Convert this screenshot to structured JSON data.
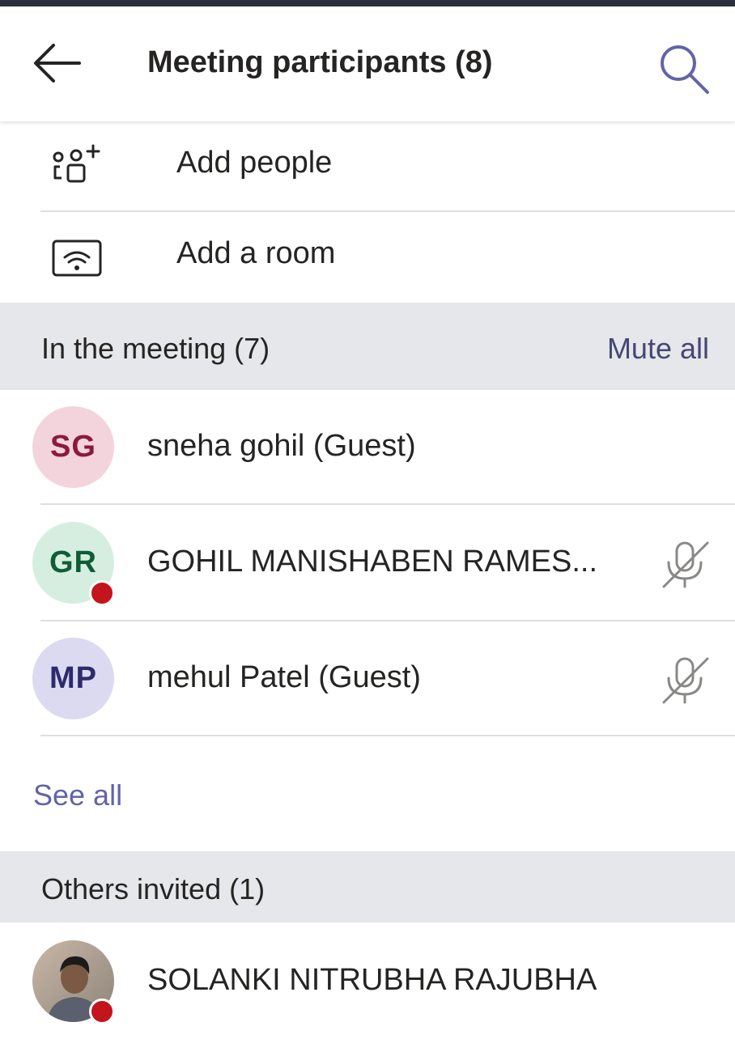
{
  "header": {
    "title": "Meeting participants (8)",
    "back_icon": "arrow-left-icon",
    "search_icon": "search-icon"
  },
  "actions": [
    {
      "label": "Add people",
      "icon": "add-people-icon"
    },
    {
      "label": "Add a room",
      "icon": "room-wifi-icon"
    }
  ],
  "in_meeting": {
    "title": "In the meeting (7)",
    "mute_all": "Mute all",
    "participants": [
      {
        "initials": "SG",
        "name": "sneha gohil (Guest)",
        "avatar_bg": "#f4d4dc",
        "avatar_fg": "#8b1a3e",
        "busy": false,
        "muted": false
      },
      {
        "initials": "GR",
        "name": "GOHIL MANISHABEN RAMES...",
        "avatar_bg": "#d6eedf",
        "avatar_fg": "#0f5d37",
        "busy": true,
        "muted": true
      },
      {
        "initials": "MP",
        "name": "mehul Patel (Guest)",
        "avatar_bg": "#dcdaf0",
        "avatar_fg": "#2d2b6e",
        "busy": false,
        "muted": true
      }
    ],
    "see_all": "See all"
  },
  "others_invited": {
    "title": "Others invited (1)",
    "participants": [
      {
        "name": "SOLANKI NITRUBHA RAJUBHA",
        "busy": true
      }
    ]
  },
  "colors": {
    "accent": "#6264a7",
    "busy": "#c4151c",
    "section_bg": "#e6e7ea"
  }
}
